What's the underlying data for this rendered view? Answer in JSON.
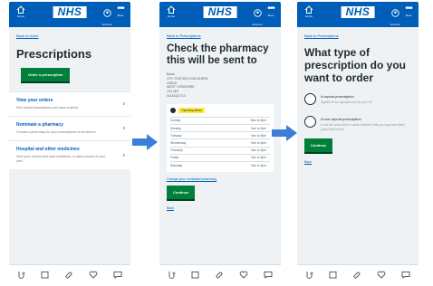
{
  "common": {
    "home_label": "Home",
    "logo": "NHS",
    "account_label": "Account",
    "more_label": "More"
  },
  "screen1": {
    "back": "Back to home",
    "title": "Prescriptions",
    "order_button": "Order a prescription",
    "cards": [
      {
        "title": "View your orders",
        "desc": "See repeat prescriptions you have ordered"
      },
      {
        "title": "Nominate a pharmacy",
        "desc": "Choose a pharmacy for your prescriptions to be sent to"
      },
      {
        "title": "Hospital and other medicines",
        "desc": "View your current and past medicines, or add a record of your own"
      }
    ]
  },
  "screen2": {
    "back": "Back to Prescriptions",
    "title": "Check the pharmacy this will be sent to",
    "address": [
      "Boots",
      "CITY STATION CONCOURSE",
      "LEEDS",
      "WEST YORKSHIRE",
      "LS1 4DT",
      "01132421713"
    ],
    "opening_label": "Opening times",
    "hours": [
      {
        "day": "Sunday",
        "time": "9am to 6pm"
      },
      {
        "day": "Monday",
        "time": "7am to 9pm"
      },
      {
        "day": "Tuesday",
        "time": "7am to 9pm"
      },
      {
        "day": "Wednesday",
        "time": "7am to 9pm"
      },
      {
        "day": "Thursday",
        "time": "7am to 9pm"
      },
      {
        "day": "Friday",
        "time": "7am to 9pm"
      },
      {
        "day": "Saturday",
        "time": "7am to 9pm"
      }
    ],
    "change_link": "Change your nominated pharmacy",
    "continue_button": "Continue",
    "back_link": "Back"
  },
  "screen3": {
    "back": "Back to Prescriptions",
    "title": "What type of prescription do you want to order",
    "options": [
      {
        "label": "A repeat prescription",
        "hint": "Signed off for repeated use by your GP"
      },
      {
        "label": "A non-repeat prescription",
        "hint": "A one-off, short-term or acute medicine that you may have been prescribed before"
      }
    ],
    "continue_button": "Continue",
    "back_link": "Back"
  },
  "colors": {
    "nhs_blue": "#005eb8",
    "button_green": "#007f3b",
    "highlight_yellow": "#ffeb3b",
    "arrow_blue": "#3b7fd9"
  },
  "tab_icons": [
    "advice-icon",
    "appointments-icon",
    "prescriptions-icon",
    "health-record-icon",
    "messages-icon"
  ]
}
